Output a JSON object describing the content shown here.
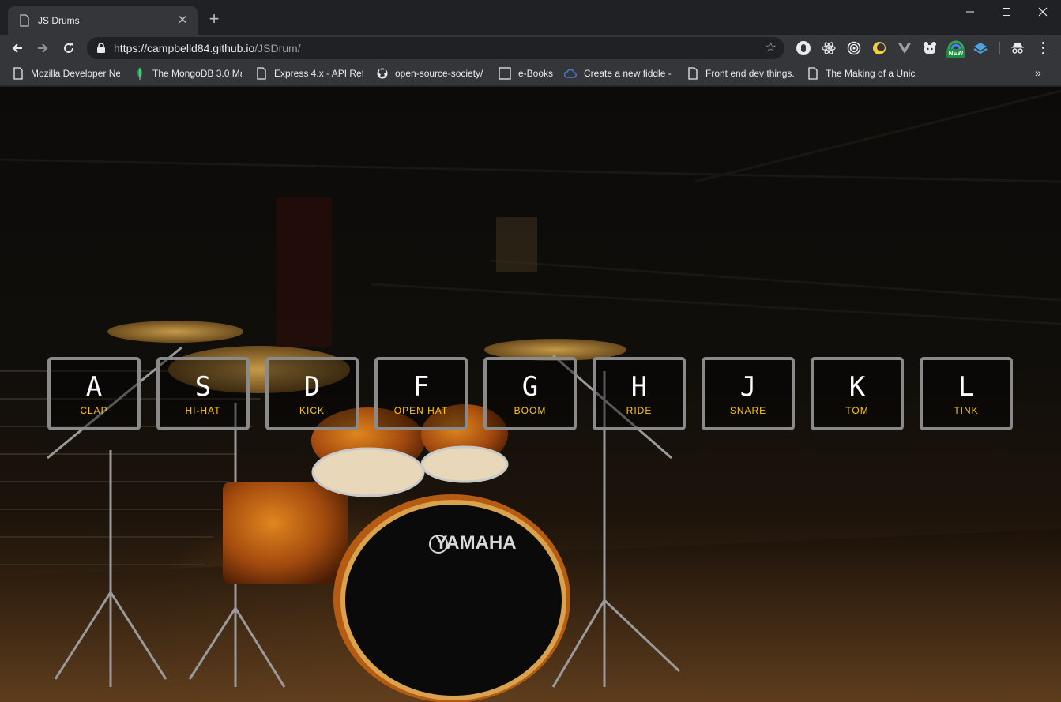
{
  "browser": {
    "tab_title": "JS Drums",
    "url_host": "https://campbelld84.github.io",
    "url_path": "/JSDrum/",
    "bookmarks": [
      "Mozilla Developer Ne",
      "The MongoDB 3.0 Ma",
      "Express 4.x - API Refe",
      "open-source-society/",
      "e-Books",
      "Create a new fiddle -",
      "Front end dev things.",
      "The Making of a Unic"
    ],
    "extension_badge": "NEW"
  },
  "page": {
    "brand_text": "YAMAHA",
    "keys": [
      {
        "key": "A",
        "sound": "CLAP"
      },
      {
        "key": "S",
        "sound": "HI-HAT"
      },
      {
        "key": "D",
        "sound": "KICK"
      },
      {
        "key": "F",
        "sound": "OPEN HAT"
      },
      {
        "key": "G",
        "sound": "BOOM"
      },
      {
        "key": "H",
        "sound": "RIDE"
      },
      {
        "key": "J",
        "sound": "SNARE"
      },
      {
        "key": "K",
        "sound": "TOM"
      },
      {
        "key": "L",
        "sound": "TINK"
      }
    ]
  },
  "colors": {
    "key_label": "#ffffff",
    "sound_label": "#ffc600",
    "key_border": "#8a8a8a",
    "chrome_bg": "#202124",
    "toolbar_bg": "#35363a"
  }
}
